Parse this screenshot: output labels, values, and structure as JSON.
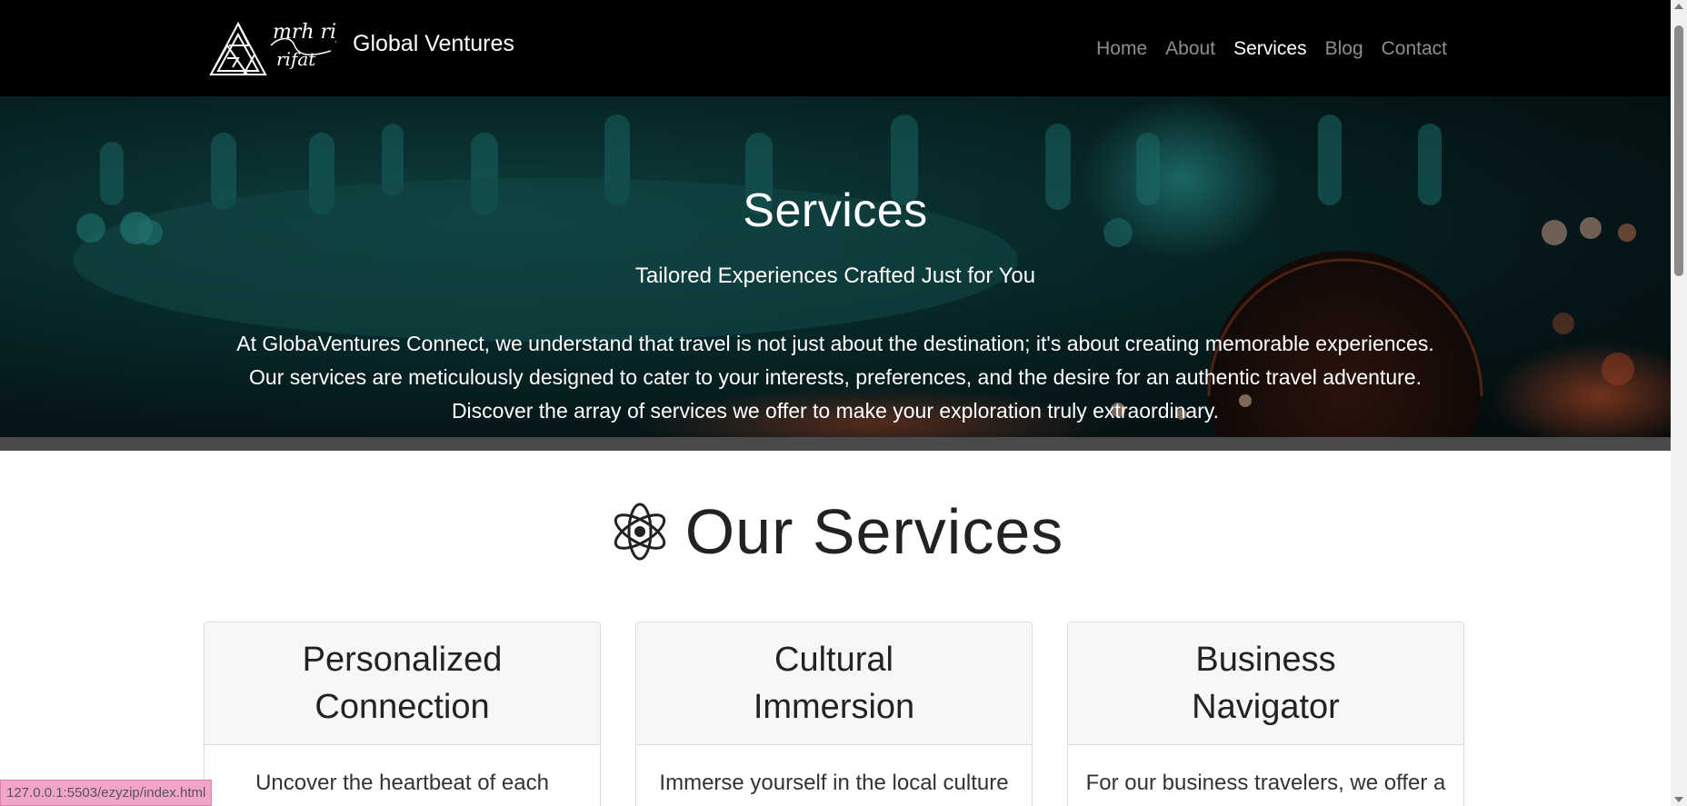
{
  "navbar": {
    "logo_text": "mrh rifat",
    "brand": "Global Ventures",
    "items": [
      {
        "label": "Home",
        "active": false
      },
      {
        "label": "About",
        "active": false
      },
      {
        "label": "Services",
        "active": true
      },
      {
        "label": "Blog",
        "active": false
      },
      {
        "label": "Contact",
        "active": false
      }
    ]
  },
  "hero": {
    "title": "Services",
    "lead": "Tailored Experiences Crafted Just for You",
    "desc_lines": [
      "At GlobaVentures Connect, we understand that travel is not just about the destination; it's about creating memorable experiences.",
      "Our services are meticulously designed to cater to your interests, preferences, and the desire for an authentic travel adventure.",
      "Discover the array of services we offer to make your exploration truly extraordinary."
    ]
  },
  "services": {
    "title": "Our Services",
    "icon": "atom-icon",
    "cards": [
      {
        "title": "Personalized Connection",
        "text": "Uncover the heartbeat of each"
      },
      {
        "title": "Cultural Immersion",
        "text": "Immerse yourself in the local culture"
      },
      {
        "title": "Business Navigator",
        "text": "For our business travelers, we offer a"
      }
    ]
  },
  "status_url": "127.0.0.1:5503/ezyzip/index.html",
  "colors": {
    "navbar_bg": "#000000",
    "hero_teal": "#145c5b",
    "card_head_bg": "#f7f7f7",
    "status_bg": "#f3a4c9"
  }
}
